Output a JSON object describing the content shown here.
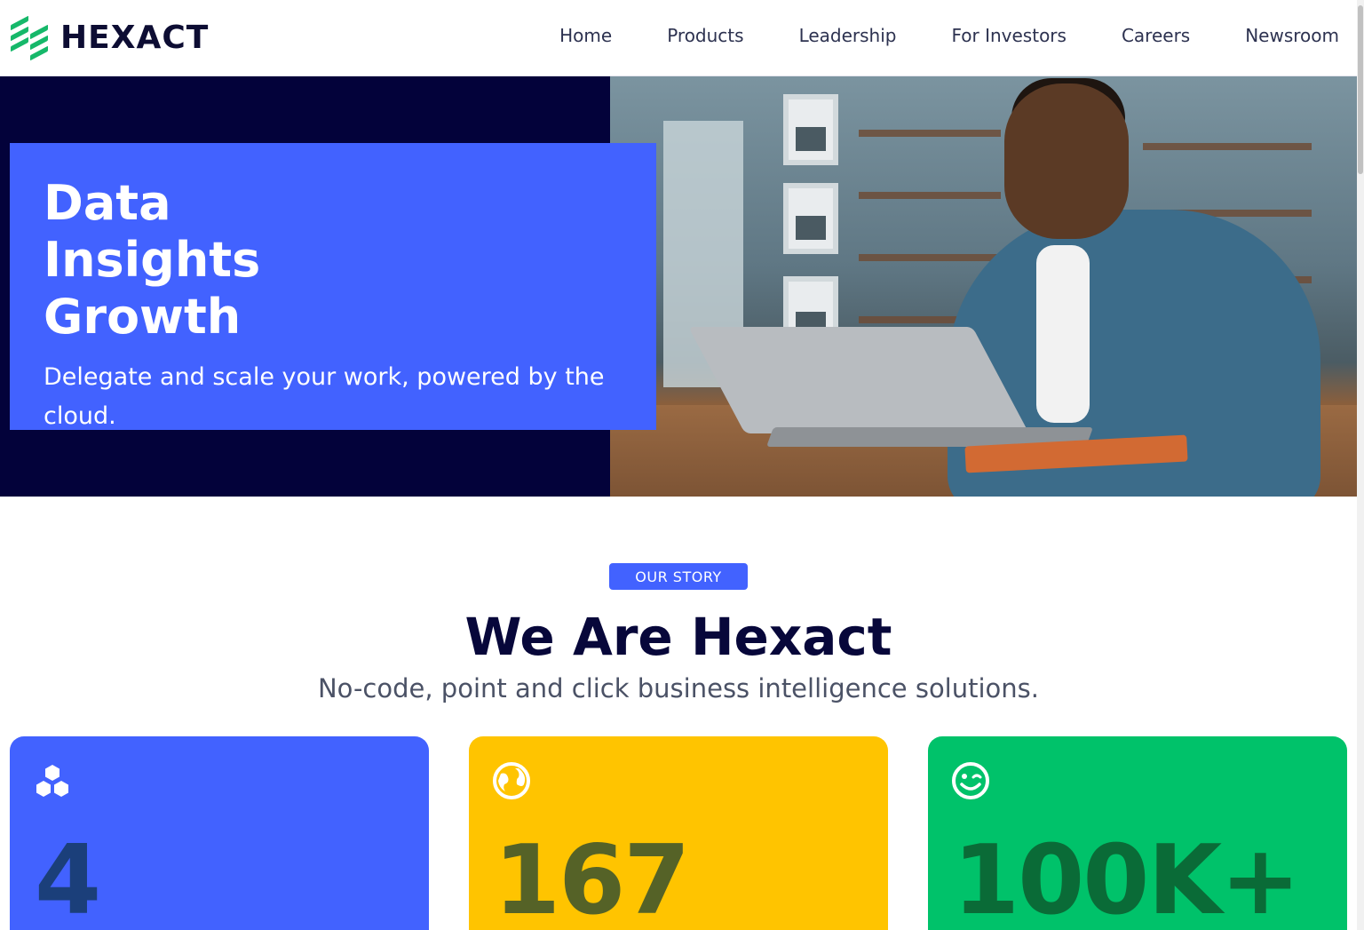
{
  "header": {
    "logo_text": "HEXACT",
    "nav": [
      {
        "label": "Home"
      },
      {
        "label": "Products"
      },
      {
        "label": "Leadership"
      },
      {
        "label": "For Investors"
      },
      {
        "label": "Careers"
      },
      {
        "label": "Newsroom"
      }
    ]
  },
  "hero": {
    "title_lines": [
      "Data",
      "Insights",
      "Growth"
    ],
    "subtitle": "Delegate and scale your work, powered by the cloud.",
    "image_icon": "photo-man-using-laptop"
  },
  "story": {
    "badge": "OUR STORY",
    "title": "We Are Hexact",
    "subtitle": "No-code, point and click business intelligence solutions."
  },
  "stats": [
    {
      "icon": "hexagons-icon",
      "value": "4",
      "bg": "#4262ff",
      "fg": "#1b3f7a"
    },
    {
      "icon": "globe-icon",
      "value": "167",
      "bg": "#ffc400",
      "fg": "#556227"
    },
    {
      "icon": "smile-wink-icon",
      "value": "100K+",
      "bg": "#00c26a",
      "fg": "#0a6b37"
    }
  ],
  "colors": {
    "brand_green": "#16b86a",
    "accent_blue": "#4262ff",
    "hero_dark": "#03023a",
    "heading_dark": "#07073a"
  }
}
